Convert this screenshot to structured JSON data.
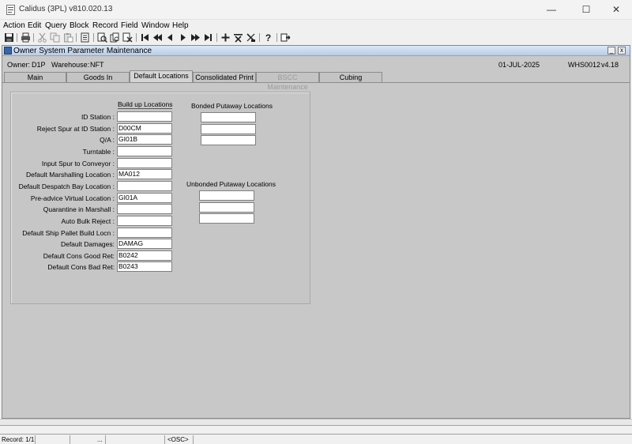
{
  "window": {
    "title": "Calidus (3PL) v810.020.13"
  },
  "window_controls": {
    "minimize": "—",
    "maximize": "☐",
    "close": "✕"
  },
  "menu": [
    "Action",
    "Edit",
    "Query",
    "Block",
    "Record",
    "Field",
    "Window",
    "Help"
  ],
  "toolbar_icons": [
    "save-icon",
    "print-icon",
    "cut-icon",
    "copy-icon",
    "paste-icon",
    "clear-record-icon",
    "enter-query-icon",
    "execute-query-icon",
    "cancel-query-icon",
    "first-record-icon",
    "previous-block-icon",
    "previous-record-icon",
    "next-record-icon",
    "next-block-icon",
    "last-record-icon",
    "insert-record-icon",
    "delete-record-icon",
    "clear-field-icon",
    "help-icon",
    "exit-icon"
  ],
  "form": {
    "title": "Owner System Parameter Maintenance",
    "min_glyph": "_",
    "close_glyph": "x",
    "owner_label": "Owner:",
    "owner_value": "D1P",
    "warehouse_label": "Warehouse:",
    "warehouse_value": "NFT",
    "date": "01-JUL-2025",
    "screen_id": "WHS0012",
    "version": "v4.18"
  },
  "tabs": [
    {
      "label": "Main",
      "state": "normal"
    },
    {
      "label": "Goods In",
      "state": "normal"
    },
    {
      "label": "Default Locations",
      "state": "active"
    },
    {
      "label": "Consolidated Print",
      "state": "normal"
    },
    {
      "label": "BSCC Maintenance",
      "state": "disabled"
    },
    {
      "label": "Cubing",
      "state": "normal"
    }
  ],
  "headers": {
    "build_up": "Build up Locations",
    "bonded": "Bonded Putaway Locations",
    "unbonded": "Unbonded Putaway Locations"
  },
  "fields": [
    {
      "label": "ID Station :",
      "value": ""
    },
    {
      "label": "Reject Spur at ID Station :",
      "value": "D00CM"
    },
    {
      "label": "Q/A :",
      "value": "GI01B"
    },
    {
      "label": "Turntable :",
      "value": ""
    },
    {
      "label": "Input Spur to Conveyor :",
      "value": ""
    },
    {
      "label": "Default Marshalling Location :",
      "value": "MA012"
    },
    {
      "label": "Default Despatch Bay Location :",
      "value": ""
    },
    {
      "label": "Pre-advice Virtual Location :",
      "value": "GI01A"
    },
    {
      "label": "Quarantine in Marshall :",
      "value": ""
    },
    {
      "label": "Auto Bulk Reject :",
      "value": ""
    },
    {
      "label": "Default Ship Pallet Build Locn :",
      "value": ""
    },
    {
      "label": "Default Damages:",
      "value": "DAMAG"
    },
    {
      "label": "Default Cons Good Ret:",
      "value": "B0242"
    },
    {
      "label": "Default Cons Bad Ret:",
      "value": "B0243"
    }
  ],
  "bonded_fields": [
    "",
    "",
    ""
  ],
  "unbonded_fields": [
    "",
    "",
    ""
  ],
  "status": {
    "record": "Record: 1/1",
    "dots": "...",
    "mode": "<OSC>"
  }
}
